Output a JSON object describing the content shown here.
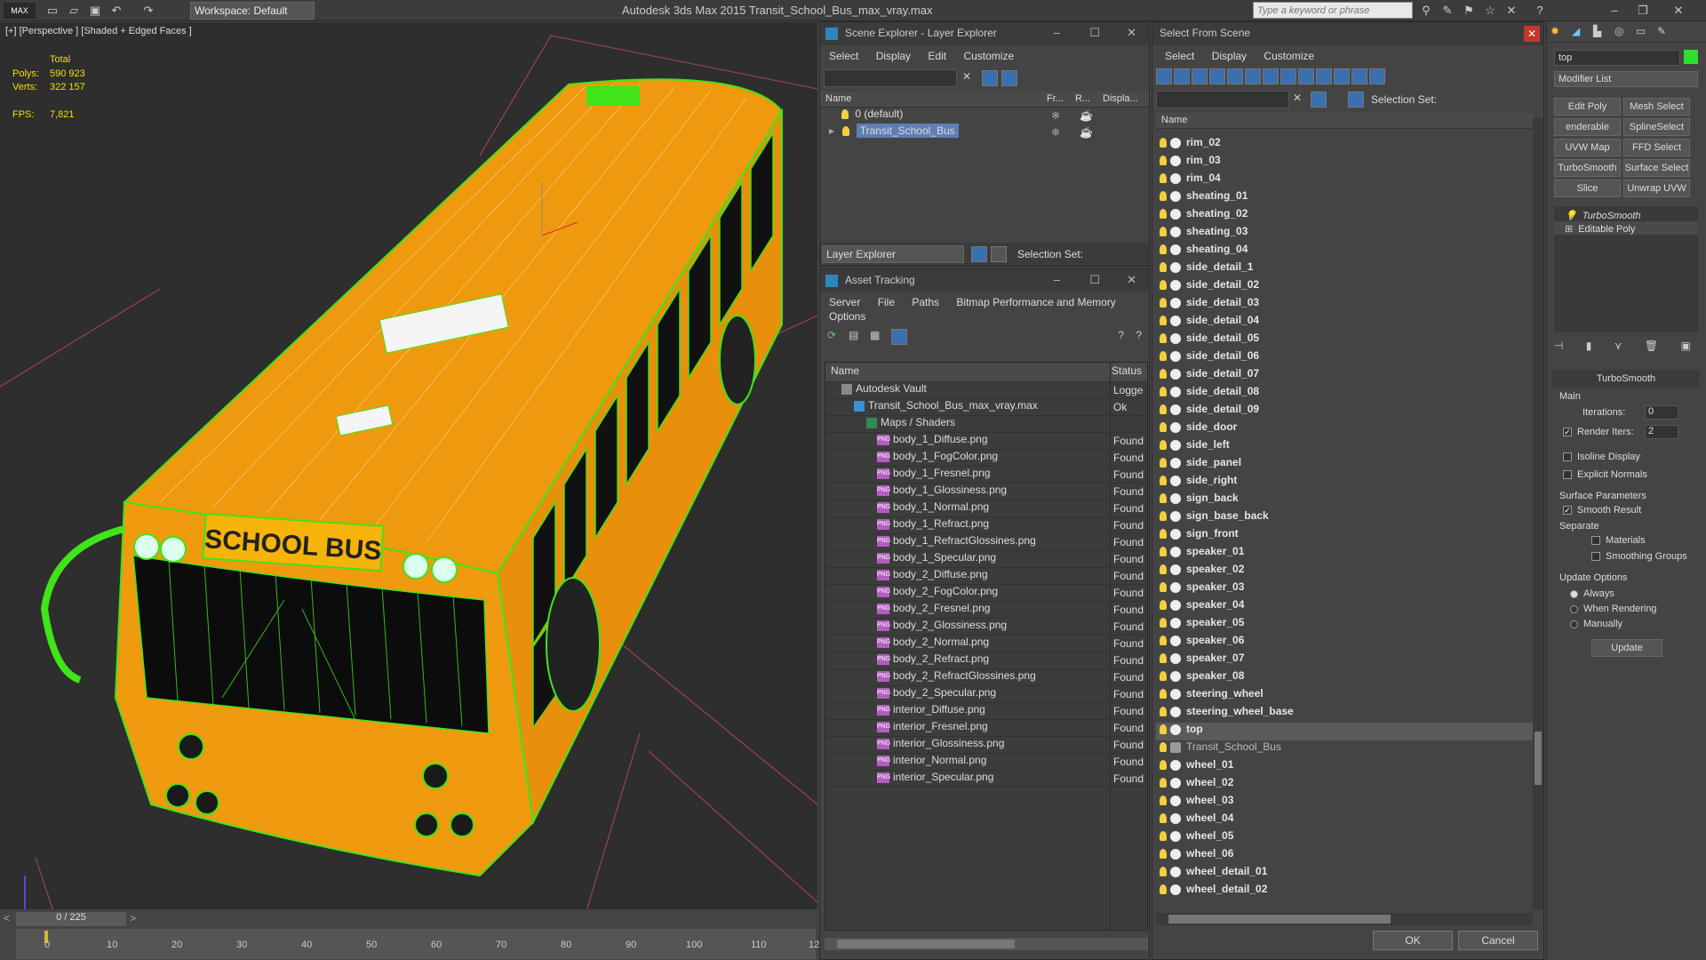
{
  "titlebar": {
    "app_title": "Autodesk 3ds Max  2015      Transit_School_Bus_max_vray.max",
    "workspace": "Workspace: Default",
    "search_placeholder": "Type a keyword or phrase"
  },
  "viewport": {
    "label": "[+] [Perspective ] [Shaded + Edged Faces ]",
    "stats": {
      "total_label": "Total",
      "polys_label": "Polys:",
      "polys_value": "590 923",
      "verts_label": "Verts:",
      "verts_value": "322 157",
      "fps_label": "FPS:",
      "fps_value": "7,821"
    },
    "sign_text": "SCHOOL BUS"
  },
  "timeline": {
    "frame": "0 / 225",
    "ticks": [
      "0",
      "10",
      "20",
      "30",
      "40",
      "50",
      "60",
      "70",
      "80",
      "90",
      "100",
      "110",
      "12"
    ]
  },
  "scene_explorer": {
    "title": "Scene Explorer - Layer Explorer",
    "menu": [
      "Select",
      "Display",
      "Edit",
      "Customize"
    ],
    "columns": [
      "Name",
      "Fr...",
      "R...",
      "Displa..."
    ],
    "rows": [
      {
        "name": "0 (default)",
        "selected": false
      },
      {
        "name": "Transit_School_Bus",
        "selected": true
      }
    ],
    "footer_dropdown": "Layer Explorer",
    "selection_set_label": "Selection Set:"
  },
  "asset_tracking": {
    "title": "Asset Tracking",
    "menu": [
      "Server",
      "File",
      "Paths",
      "Bitmap Performance and Memory"
    ],
    "menu2": "Options",
    "columns": [
      "Name",
      "Status"
    ],
    "rows": [
      {
        "name": "Autodesk Vault",
        "status": "Logge"
      },
      {
        "name": "Transit_School_Bus_max_vray.max",
        "status": "Ok"
      },
      {
        "name": "Maps / Shaders",
        "status": ""
      },
      {
        "name": "body_1_Diffuse.png",
        "status": "Found"
      },
      {
        "name": "body_1_FogColor.png",
        "status": "Found"
      },
      {
        "name": "body_1_Fresnel.png",
        "status": "Found"
      },
      {
        "name": "body_1_Glossiness.png",
        "status": "Found"
      },
      {
        "name": "body_1_Normal.png",
        "status": "Found"
      },
      {
        "name": "body_1_Refract.png",
        "status": "Found"
      },
      {
        "name": "body_1_RefractGlossines.png",
        "status": "Found"
      },
      {
        "name": "body_1_Specular.png",
        "status": "Found"
      },
      {
        "name": "body_2_Diffuse.png",
        "status": "Found"
      },
      {
        "name": "body_2_FogColor.png",
        "status": "Found"
      },
      {
        "name": "body_2_Fresnel.png",
        "status": "Found"
      },
      {
        "name": "body_2_Glossiness.png",
        "status": "Found"
      },
      {
        "name": "body_2_Normal.png",
        "status": "Found"
      },
      {
        "name": "body_2_Refract.png",
        "status": "Found"
      },
      {
        "name": "body_2_RefractGlossines.png",
        "status": "Found"
      },
      {
        "name": "body_2_Specular.png",
        "status": "Found"
      },
      {
        "name": "interior_Diffuse.png",
        "status": "Found"
      },
      {
        "name": "interior_Fresnel.png",
        "status": "Found"
      },
      {
        "name": "interior_Glossiness.png",
        "status": "Found"
      },
      {
        "name": "interior_Normal.png",
        "status": "Found"
      },
      {
        "name": "interior_Specular.png",
        "status": "Found"
      }
    ]
  },
  "select_from_scene": {
    "title": "Select From Scene",
    "menu": [
      "Select",
      "Display",
      "Customize"
    ],
    "selection_set_label": "Selection Set:",
    "column": "Name",
    "items": [
      {
        "name": "rim_02",
        "bold": true
      },
      {
        "name": "rim_03",
        "bold": true
      },
      {
        "name": "rim_04",
        "bold": true
      },
      {
        "name": "sheating_01",
        "bold": true
      },
      {
        "name": "sheating_02",
        "bold": true
      },
      {
        "name": "sheating_03",
        "bold": true
      },
      {
        "name": "sheating_04",
        "bold": true
      },
      {
        "name": "side_detail_1",
        "bold": true
      },
      {
        "name": "side_detail_02",
        "bold": true
      },
      {
        "name": "side_detail_03",
        "bold": true
      },
      {
        "name": "side_detail_04",
        "bold": true
      },
      {
        "name": "side_detail_05",
        "bold": true
      },
      {
        "name": "side_detail_06",
        "bold": true
      },
      {
        "name": "side_detail_07",
        "bold": true
      },
      {
        "name": "side_detail_08",
        "bold": true
      },
      {
        "name": "side_detail_09",
        "bold": true
      },
      {
        "name": "side_door",
        "bold": true
      },
      {
        "name": "side_left",
        "bold": true
      },
      {
        "name": "side_panel",
        "bold": true
      },
      {
        "name": "side_right",
        "bold": true
      },
      {
        "name": "sign_back",
        "bold": true
      },
      {
        "name": "sign_base_back",
        "bold": true
      },
      {
        "name": "sign_front",
        "bold": true
      },
      {
        "name": "speaker_01",
        "bold": true
      },
      {
        "name": "speaker_02",
        "bold": true
      },
      {
        "name": "speaker_03",
        "bold": true
      },
      {
        "name": "speaker_04",
        "bold": true
      },
      {
        "name": "speaker_05",
        "bold": true
      },
      {
        "name": "speaker_06",
        "bold": true
      },
      {
        "name": "speaker_07",
        "bold": true
      },
      {
        "name": "speaker_08",
        "bold": true
      },
      {
        "name": "steering_wheel",
        "bold": true
      },
      {
        "name": "steering_wheel_base",
        "bold": true
      },
      {
        "name": "top",
        "bold": true,
        "highlight": true
      },
      {
        "name": "Transit_School_Bus",
        "bold": false
      },
      {
        "name": "wheel_01",
        "bold": true
      },
      {
        "name": "wheel_02",
        "bold": true
      },
      {
        "name": "wheel_03",
        "bold": true
      },
      {
        "name": "wheel_04",
        "bold": true
      },
      {
        "name": "wheel_05",
        "bold": true
      },
      {
        "name": "wheel_06",
        "bold": true
      },
      {
        "name": "wheel_detail_01",
        "bold": true
      },
      {
        "name": "wheel_detail_02",
        "bold": true
      }
    ],
    "ok": "OK",
    "cancel": "Cancel"
  },
  "command_panel": {
    "name_field": "top",
    "modifier_list": "Modifier List",
    "buttons": [
      "Edit Poly",
      "Mesh Select",
      "enderable Splir",
      "SplineSelect",
      "UVW Map",
      "FFD Select",
      "TurboSmooth",
      "Surface Select",
      "Slice",
      "Unwrap UVW"
    ],
    "stack": [
      "TurboSmooth",
      "Editable Poly"
    ],
    "rollout_title": "TurboSmooth",
    "main_label": "Main",
    "iterations_label": "Iterations:",
    "iterations_value": "0",
    "render_iters_label": "Render Iters:",
    "render_iters_value": "2",
    "isoline": "Isoline Display",
    "explicit_normals": "Explicit Normals",
    "surface_params": "Surface Parameters",
    "smooth_result": "Smooth Result",
    "separate": "Separate",
    "materials": "Materials",
    "smoothing_groups": "Smoothing Groups",
    "update_options": "Update Options",
    "always": "Always",
    "when_rendering": "When Rendering",
    "manually": "Manually",
    "update": "Update"
  }
}
